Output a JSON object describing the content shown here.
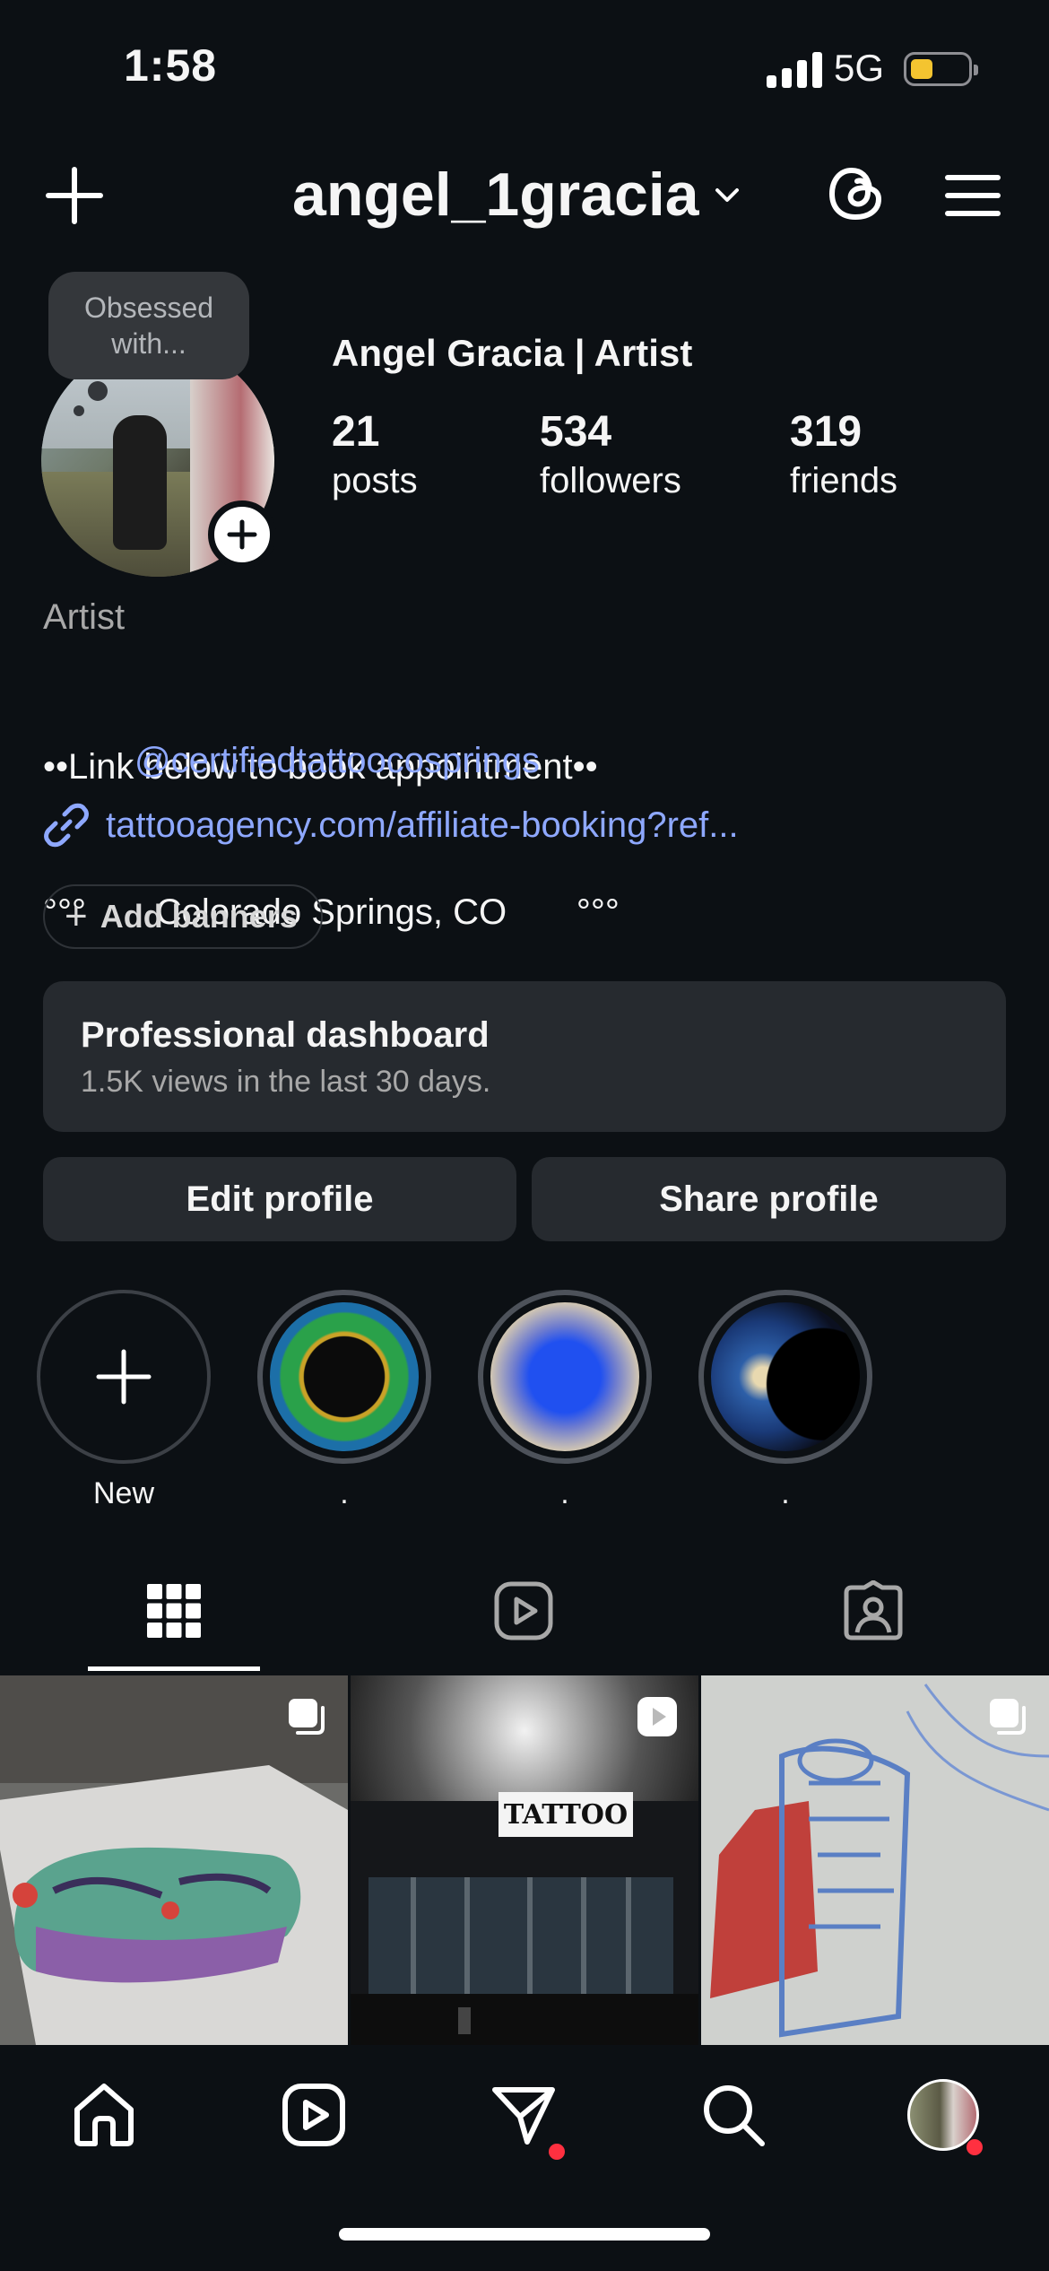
{
  "status_bar": {
    "time": "1:58",
    "network": "5G"
  },
  "header": {
    "username": "angel_1gracia"
  },
  "profile": {
    "note": "Obsessed with...",
    "display_name": "Angel Gracia | Artist",
    "stats": [
      {
        "value": "21",
        "label": "posts"
      },
      {
        "value": "534",
        "label": "followers"
      },
      {
        "value": "319",
        "label": "friends"
      }
    ],
    "category": "Artist",
    "bio_lines": [
      "••Link below to book appointment••",
      "°°°       Colorado Springs, CO       °°°"
    ],
    "mention": "@certifiedtattoocosprings",
    "link": "tattooagency.com/affiliate-booking?ref...",
    "add_banners": "Add banners"
  },
  "dashboard": {
    "title": "Professional dashboard",
    "subtitle": "1.5K views in the last 30 days."
  },
  "actions": {
    "edit": "Edit profile",
    "share": "Share profile"
  },
  "highlights": [
    {
      "label": "New",
      "icon": "plus-icon"
    },
    {
      "label": ".",
      "icon": "green-ring-highlight"
    },
    {
      "label": ".",
      "icon": "blue-gradient-highlight"
    },
    {
      "label": ".",
      "icon": "earth-highlight"
    }
  ],
  "tabs": [
    "grid-icon",
    "reels-icon",
    "tagged-icon"
  ],
  "nav": [
    "home-icon",
    "reels-icon",
    "direct-messages-icon",
    "search-icon",
    "profile-avatar"
  ],
  "colors": {
    "background": "#0c1014",
    "link": "#8ea8ff",
    "surface": "#262a2f",
    "notification": "#ff3040",
    "battery": "#f4c430"
  }
}
